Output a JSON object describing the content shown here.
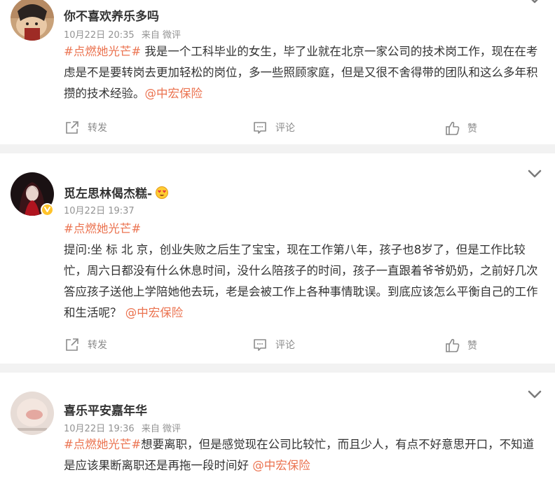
{
  "posts": [
    {
      "username": "你不喜欢养乐多吗",
      "date": "10月22日 20:35",
      "source": "来自 微评",
      "topic": "#点燃她光芒#",
      "body": " 我是一个工科毕业的女生，毕了业就在北京一家公司的技术岗工作，现在在考虑是不是要转岗去更加轻松的岗位，多一些照顾家庭，但是又很不舍得带的团队和这么多年积攒的技术经验。",
      "mention": "@中宏保险",
      "actions": {
        "repost": "转发",
        "comment": "评论",
        "like": "赞"
      }
    },
    {
      "username": "觅左思林偈杰糕-",
      "date": "10月22日 19:37",
      "source": "",
      "topic": "#点燃她光芒#",
      "body": "提问:坐 标 北 京，创业失败之后生了宝宝，现在工作第八年，孩子也8岁了，但是工作比较忙，周六日都没有什么休息时间，没什么陪孩子的时间，孩子一直跟着爷爷奶奶，之前好几次答应孩子送他上学陪她他去玩，老是会被工作上各种事情耽误。到底应该怎么平衡自己的工作和生活呢？",
      "mention": "@中宏保险",
      "actions": {
        "repost": "转发",
        "comment": "评论",
        "like": "赞"
      }
    },
    {
      "username": "喜乐平安嘉年华",
      "date": "10月22日 19:36",
      "source": "来自 微评",
      "topic": "#点燃她光芒#",
      "body": "想要离职，但是感觉现在公司比较忙，而且少人，有点不好意思开口，不知道是应该果断离职还是再拖一段时间好",
      "mention": "@中宏保险"
    }
  ],
  "colors": {
    "accent": "#eb7350",
    "meta": "#939393",
    "verified": "#ffc32a"
  },
  "icons": [
    "repost-icon",
    "comment-icon",
    "like-icon",
    "chevron-down-icon",
    "verified-badge-icon",
    "heart-eyes-emoji-icon"
  ]
}
